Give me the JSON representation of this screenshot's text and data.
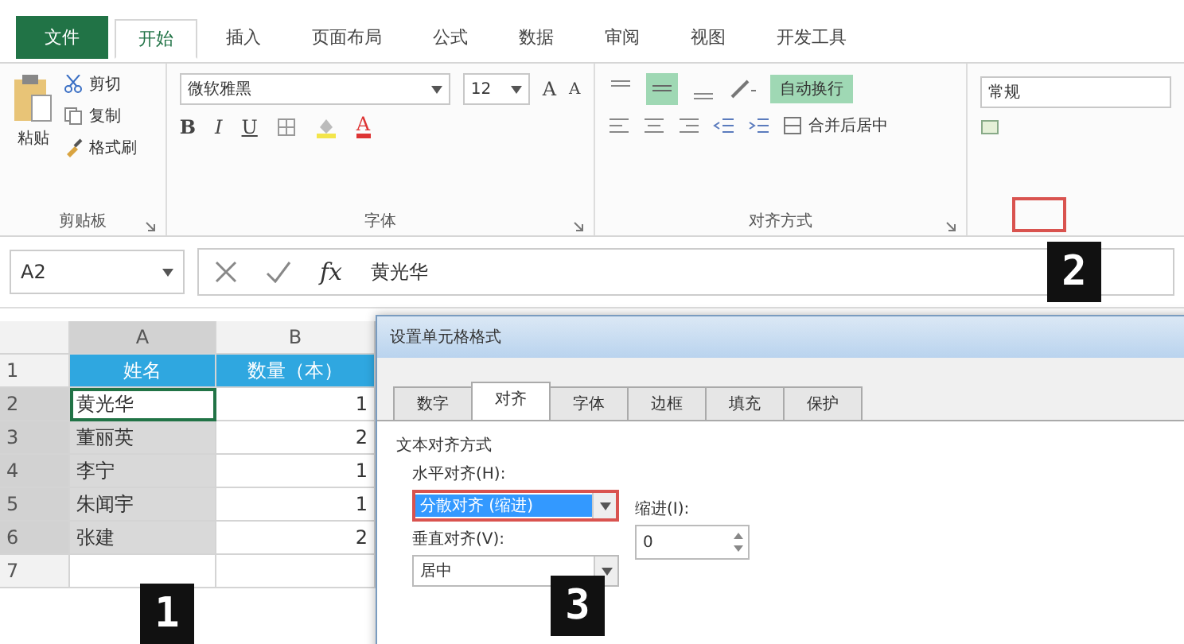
{
  "ribbon": {
    "tabs": [
      {
        "label": "文件",
        "kind": "file"
      },
      {
        "label": "开始",
        "kind": "tab",
        "selected": true
      },
      {
        "label": "插入",
        "kind": "tab",
        "selected": false
      },
      {
        "label": "页面布局",
        "kind": "tab",
        "selected": false
      },
      {
        "label": "公式",
        "kind": "tab",
        "selected": false
      },
      {
        "label": "数据",
        "kind": "tab",
        "selected": false
      },
      {
        "label": "审阅",
        "kind": "tab",
        "selected": false
      },
      {
        "label": "视图",
        "kind": "tab",
        "selected": false
      },
      {
        "label": "开发工具",
        "kind": "tab",
        "selected": false
      }
    ],
    "clipboard": {
      "paste": "粘贴",
      "cut": "剪切",
      "copy": "复制",
      "format_painter": "格式刷",
      "label": "剪贴板"
    },
    "font": {
      "font_name": "微软雅黑",
      "font_size": "12",
      "grow": "A",
      "shrink": "A",
      "bold": "B",
      "italic": "I",
      "underline": "U",
      "font_color": "A",
      "label": "字体"
    },
    "alignment": {
      "wrap_text": {
        "label": "自动换行",
        "on": true
      },
      "middle_align": {
        "on": true
      },
      "merge": "合并后居中",
      "label": "对齐方式"
    },
    "number": {
      "format": "常规"
    }
  },
  "formula_bar": {
    "name_box": "A2",
    "function_label": "fx",
    "value": "黄光华"
  },
  "sheet": {
    "columns": [
      {
        "label": "A",
        "selected": true
      },
      {
        "label": "B",
        "selected": false
      }
    ],
    "rows": [
      {
        "number": "1",
        "kind": "header",
        "selected": false,
        "cells": [
          "姓名",
          "数量（本）"
        ]
      },
      {
        "number": "2",
        "kind": "data",
        "selected": true,
        "cells": [
          "黄光华",
          "1"
        ]
      },
      {
        "number": "3",
        "kind": "data",
        "selected": true,
        "cells": [
          "董丽英",
          "2"
        ]
      },
      {
        "number": "4",
        "kind": "data",
        "selected": true,
        "cells": [
          "李宁",
          "1"
        ]
      },
      {
        "number": "5",
        "kind": "data",
        "selected": true,
        "cells": [
          "朱闻宇",
          "1"
        ]
      },
      {
        "number": "6",
        "kind": "data",
        "selected": true,
        "cells": [
          "张建",
          "2"
        ]
      },
      {
        "number": "7",
        "kind": "data",
        "selected": false,
        "cells": [
          "",
          ""
        ]
      }
    ]
  },
  "dialog": {
    "title": "设置单元格格式",
    "tabs": [
      {
        "label": "数字",
        "selected": false
      },
      {
        "label": "对齐",
        "selected": true
      },
      {
        "label": "字体",
        "selected": false
      },
      {
        "label": "边框",
        "selected": false
      },
      {
        "label": "填充",
        "selected": false
      },
      {
        "label": "保护",
        "selected": false
      }
    ],
    "section": "文本对齐方式",
    "horizontal": {
      "label": "水平对齐(H):",
      "value": "分散对齐 (缩进)"
    },
    "indent": {
      "label": "缩进(I):",
      "value": "0"
    },
    "vertical": {
      "label": "垂直对齐(V):",
      "value": "居中"
    }
  },
  "callouts": [
    "1",
    "2",
    "3"
  ]
}
